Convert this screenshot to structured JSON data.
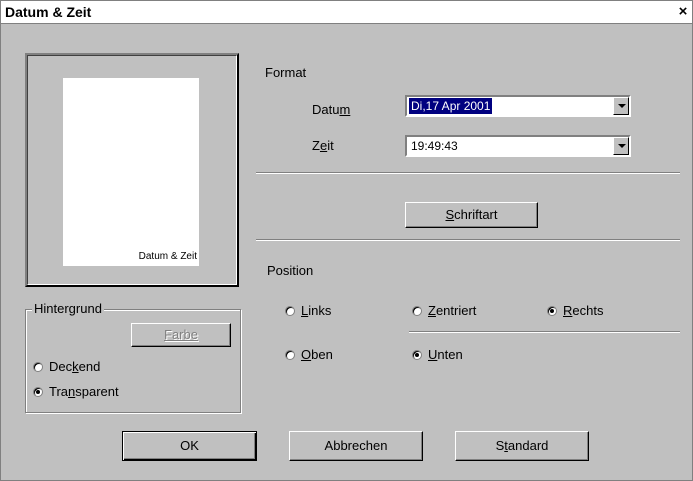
{
  "window": {
    "title": "Datum & Zeit",
    "close_glyph": "×"
  },
  "preview": {
    "page_text": "Datum & Zeit"
  },
  "background_group": {
    "legend": "Hintergrund",
    "color_button": "Farbe",
    "options": [
      {
        "pre": "Dec",
        "key": "k",
        "post": "end",
        "checked": false
      },
      {
        "pre": "Tra",
        "key": "n",
        "post": "sparent",
        "checked": true
      }
    ]
  },
  "format": {
    "heading": "Format",
    "date_label": {
      "pre": "Datu",
      "key": "m",
      "post": ""
    },
    "date_value": "Di,17 Apr 2001",
    "time_label": {
      "pre": "Z",
      "key": "e",
      "post": "it"
    },
    "time_value": "19:49:43",
    "font_button": {
      "pre": "",
      "key": "S",
      "post": "chriftart"
    }
  },
  "position": {
    "heading": "Position",
    "horizontal": [
      {
        "pre": "",
        "key": "L",
        "post": "inks",
        "checked": false
      },
      {
        "pre": "",
        "key": "Z",
        "post": "entriert",
        "checked": false
      },
      {
        "pre": "",
        "key": "R",
        "post": "echts",
        "checked": true
      }
    ],
    "vertical": [
      {
        "pre": "",
        "key": "O",
        "post": "ben",
        "checked": false
      },
      {
        "pre": "",
        "key": "U",
        "post": "nten",
        "checked": true
      }
    ]
  },
  "buttons": {
    "ok": "OK",
    "cancel": "Abbrechen",
    "standard": {
      "pre": "S",
      "key": "t",
      "post": "andard"
    }
  }
}
